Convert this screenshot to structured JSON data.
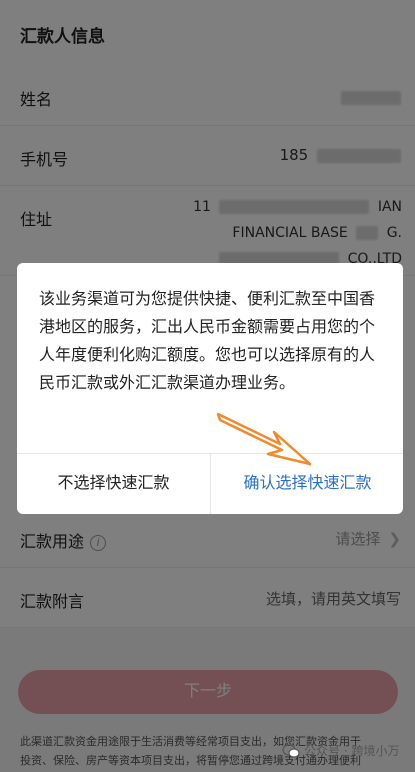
{
  "section": {
    "title": "汇款人信息"
  },
  "rows": {
    "name": {
      "label": "姓名"
    },
    "phone": {
      "label": "手机号",
      "value_prefix": "185"
    },
    "address": {
      "label": "住址",
      "line1_prefix": "11",
      "line1_suffix": "IAN",
      "line2": "FINANCIAL BASE",
      "line2_suffix": "G.",
      "line3_suffix": "CO.,LTD"
    },
    "purpose": {
      "label": "汇款用途",
      "info": "i",
      "value": "请选择"
    },
    "memo": {
      "label": "汇款附言",
      "value": "选填，请用英文填写"
    }
  },
  "next_button": {
    "label": "下一步"
  },
  "footnote": {
    "line1": "此渠道汇款资金用途限于生活消费等经常项目支出，如您汇款资金用于",
    "line2": "投资、保险、房产等资本项目支出，将暂停您通过跨境支付通办理便利"
  },
  "dialog": {
    "message": "该业务渠道可为您提供快捷、便利汇款至中国香港地区的服务，汇出人民币金额需要占用您的个人年度便利化购汇额度。您也可以选择原有的人民币汇款或外汇汇款渠道办理业务。",
    "cancel_label": "不选择快速汇款",
    "confirm_label": "确认选择快速汇款"
  },
  "watermark": {
    "text": "公众号 · 跨境小万"
  },
  "colors": {
    "accent": "#2a70c9",
    "arrow": "#f08a2c",
    "button": "#e9a0a8"
  }
}
